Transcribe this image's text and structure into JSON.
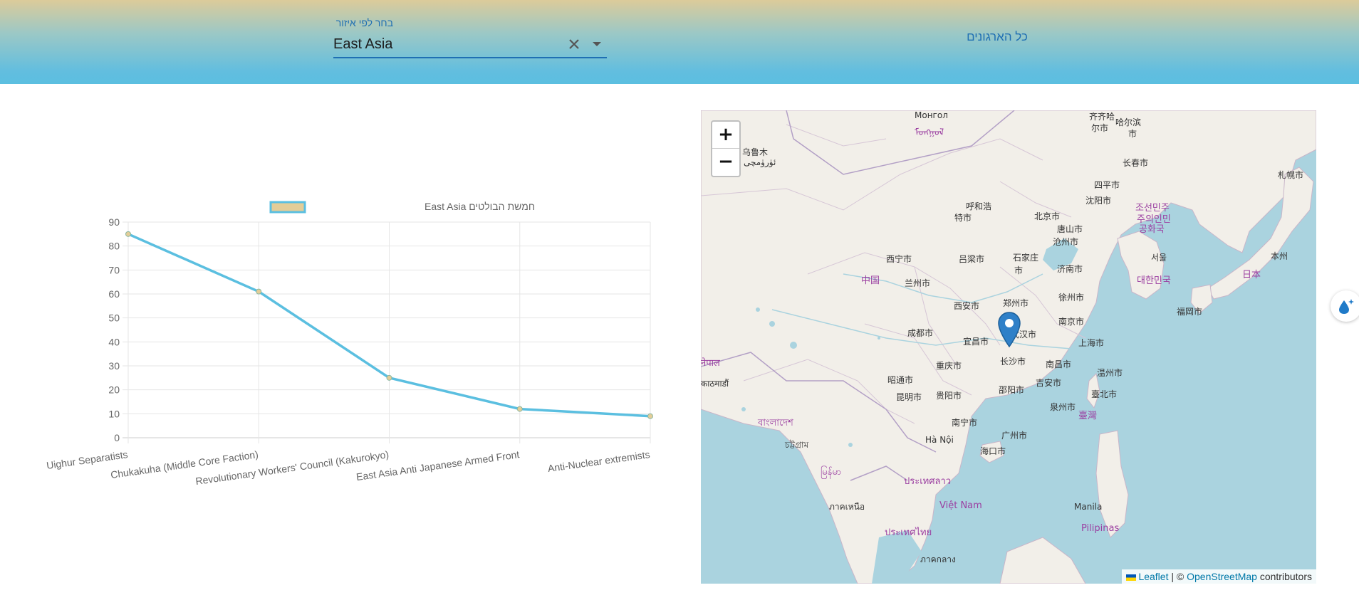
{
  "header": {
    "region_label": "בחר לפי איזור",
    "region_value": "East Asia",
    "all_orgs_label": "כל הארגונים"
  },
  "icons": {
    "clear": "close-icon",
    "dropdown": "caret-down-icon",
    "side": "water-drop-icon",
    "marker": "map-pin-icon"
  },
  "colors": {
    "accent": "#1f6fb3",
    "line": "#5bbfe0",
    "legend_fill": "#e3cd98"
  },
  "chart_data": {
    "type": "line",
    "categories": [
      "Uighur Separatists",
      "Chukakuha (Middle Core Faction)",
      "Revolutionary Workers' Council (Kakurokyo)",
      "East Asia Anti Japanese Armed Front",
      "Anti-Nuclear extremists"
    ],
    "series": [
      {
        "name": "חמשת הבולטים East Asia",
        "values": [
          85,
          61,
          25,
          12,
          9
        ]
      }
    ],
    "yticks": [
      "0",
      "10",
      "20",
      "30",
      "40",
      "50",
      "60",
      "70",
      "80",
      "90"
    ],
    "ylim": [
      0,
      90
    ],
    "grid": true,
    "legend": "top"
  },
  "map": {
    "zoom_in": "+",
    "zoom_out": "−",
    "attribution": {
      "leaflet": "Leaflet",
      "sep": " | © ",
      "osm": "OpenStreetMap",
      "contributors": " contributors"
    },
    "labels": [
      {
        "t": "Монгол"
      },
      {
        "t": "乌鲁木"
      },
      {
        "t": "ئۈرۈمچى"
      },
      {
        "t": "齐齐哈"
      },
      {
        "t": "尔市"
      },
      {
        "t": "哈尔滨"
      },
      {
        "t": "市"
      },
      {
        "t": "长春市"
      },
      {
        "t": "四平市"
      },
      {
        "t": "札幌市"
      },
      {
        "t": "沈阳市"
      },
      {
        "t": "呼和浩"
      },
      {
        "t": "特市"
      },
      {
        "t": "北京市"
      },
      {
        "t": "唐山市"
      },
      {
        "t": "沧州市"
      },
      {
        "t": "西宁市"
      },
      {
        "t": "吕梁市"
      },
      {
        "t": "石家庄"
      },
      {
        "t": "市"
      },
      {
        "t": "济南市"
      },
      {
        "t": "서울"
      },
      {
        "t": "本州"
      },
      {
        "t": "兰州市"
      },
      {
        "t": "郑州市"
      },
      {
        "t": "徐州市"
      },
      {
        "t": "西安市"
      },
      {
        "t": "南京市"
      },
      {
        "t": "福岡市"
      },
      {
        "t": "成都市"
      },
      {
        "t": "宜昌市"
      },
      {
        "t": "武汉市"
      },
      {
        "t": "上海市"
      },
      {
        "t": "重庆市"
      },
      {
        "t": "长沙市"
      },
      {
        "t": "南昌市"
      },
      {
        "t": "温州市"
      },
      {
        "t": "昭通市"
      },
      {
        "t": "吉安市"
      },
      {
        "t": "昆明市"
      },
      {
        "t": "贵阳市"
      },
      {
        "t": "邵阳市"
      },
      {
        "t": "臺北市"
      },
      {
        "t": "泉州市"
      },
      {
        "t": "काठमाडौं"
      },
      {
        "t": "南宁市"
      },
      {
        "t": "广州市"
      },
      {
        "t": "চট্টগ্রাম"
      },
      {
        "t": "Hà Nội"
      },
      {
        "t": "海口市"
      },
      {
        "t": "Manila"
      },
      {
        "t": "ภาคเหนือ"
      },
      {
        "t": "ภาคกลาง"
      }
    ],
    "countries": [
      {
        "t": "中国"
      },
      {
        "t": "조선민주"
      },
      {
        "t": "주의인민"
      },
      {
        "t": "공화국"
      },
      {
        "t": "대한민국"
      },
      {
        "t": "日本"
      },
      {
        "t": "বাংলাদেশ"
      },
      {
        "t": "မြန်မာ"
      },
      {
        "t": "ประเทศลาว"
      },
      {
        "t": "Việt Nam"
      },
      {
        "t": "ประเทศไทย"
      },
      {
        "t": "Pilipinas"
      },
      {
        "t": "臺灣"
      },
      {
        "t": "नेपाल"
      },
      {
        "t": "ᠮᠣᠩᠭᠣᠯ"
      }
    ]
  }
}
